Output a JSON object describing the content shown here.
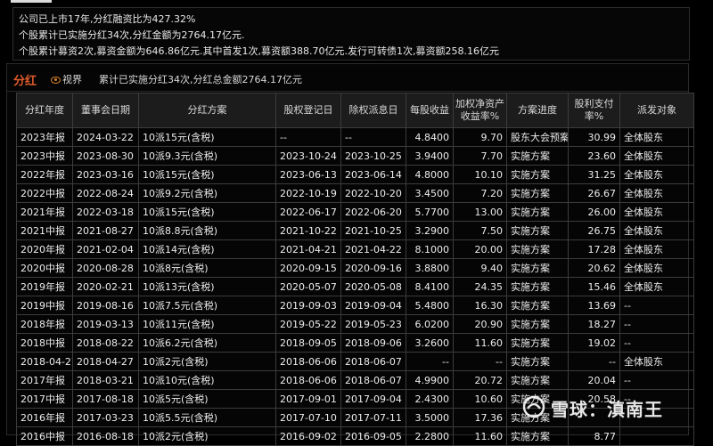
{
  "summary": {
    "line1": "公司已上市17年,分红融资比为427.32%",
    "line2": "个股累计已实施分红34次,分红金额为2764.17亿元.",
    "line3": "个股累计募资2次,募资金额为646.86亿元.其中首发1次,募资额388.70亿元.发行可转债1次,募资额258.16亿元"
  },
  "section": {
    "title": "分红",
    "view_label": "视界",
    "summary": "累计已实施分红34次,分红总金额2764.17亿元"
  },
  "table": {
    "headers": [
      "分红年度",
      "董事会日期",
      "分红方案",
      "股权登记日",
      "除权派息日",
      "每股收益",
      "加权净资产收益率%",
      "方案进度",
      "股利支付率%",
      "派发对象"
    ],
    "rows": [
      [
        "2023年报",
        "2024-03-22",
        "10派15元(含税)",
        "--",
        "--",
        "4.8400",
        "9.70",
        "股东大会预案",
        "30.99",
        "全体股东"
      ],
      [
        "2023中报",
        "2023-08-30",
        "10派9.3元(含税)",
        "2023-10-24",
        "2023-10-25",
        "3.9400",
        "7.70",
        "实施方案",
        "23.60",
        "全体股东"
      ],
      [
        "2022年报",
        "2023-03-16",
        "10派15元(含税)",
        "2023-06-13",
        "2023-06-14",
        "4.8000",
        "10.10",
        "实施方案",
        "31.25",
        "全体股东"
      ],
      [
        "2022中报",
        "2022-08-24",
        "10派9.2元(含税)",
        "2022-10-19",
        "2022-10-20",
        "3.4500",
        "7.20",
        "实施方案",
        "26.67",
        "全体股东"
      ],
      [
        "2021年报",
        "2022-03-18",
        "10派15元(含税)",
        "2022-06-17",
        "2022-06-20",
        "5.7700",
        "13.00",
        "实施方案",
        "26.00",
        "全体股东"
      ],
      [
        "2021中报",
        "2021-08-27",
        "10派8.8元(含税)",
        "2021-10-22",
        "2021-10-25",
        "3.2900",
        "7.50",
        "实施方案",
        "26.75",
        "全体股东"
      ],
      [
        "2020年报",
        "2021-02-04",
        "10派14元(含税)",
        "2021-04-21",
        "2021-04-22",
        "8.1000",
        "20.00",
        "实施方案",
        "17.28",
        "全体股东"
      ],
      [
        "2020中报",
        "2020-08-28",
        "10派8元(含税)",
        "2020-09-15",
        "2020-09-16",
        "3.8800",
        "9.40",
        "实施方案",
        "20.62",
        "全体股东"
      ],
      [
        "2019年报",
        "2020-02-21",
        "10派13元(含税)",
        "2020-05-07",
        "2020-05-08",
        "8.4100",
        "24.35",
        "实施方案",
        "15.46",
        "全体股东"
      ],
      [
        "2019中报",
        "2019-08-16",
        "10派7.5元(含税)",
        "2019-09-03",
        "2019-09-04",
        "5.4800",
        "16.30",
        "实施方案",
        "13.69",
        "--"
      ],
      [
        "2018年报",
        "2019-03-13",
        "10派11元(含税)",
        "2019-05-22",
        "2019-05-23",
        "6.0200",
        "20.90",
        "实施方案",
        "18.27",
        "--"
      ],
      [
        "2018中报",
        "2018-08-22",
        "10派6.2元(含税)",
        "2018-09-05",
        "2018-09-06",
        "3.2600",
        "11.60",
        "实施方案",
        "19.02",
        "--"
      ],
      [
        "2018-04-27",
        "2018-04-27",
        "10派2元(含税)",
        "2018-06-06",
        "2018-06-07",
        "--",
        "--",
        "实施方案",
        "--",
        "全体股东"
      ],
      [
        "2017年报",
        "2018-03-21",
        "10派10元(含税)",
        "2018-06-06",
        "2018-06-07",
        "4.9900",
        "20.72",
        "实施方案",
        "20.04",
        "--"
      ],
      [
        "2017中报",
        "2017-08-18",
        "10派5元(含税)",
        "2017-09-01",
        "2017-09-04",
        "2.4300",
        "10.60",
        "实施方案",
        "20.58",
        "--"
      ],
      [
        "2016年报",
        "2017-03-23",
        "10派5.5元(含税)",
        "2017-07-10",
        "2017-07-11",
        "3.5000",
        "17.36",
        "实施方案",
        "",
        ""
      ],
      [
        "2016中报",
        "2016-08-18",
        "10派2元(含税)",
        "2016-09-02",
        "2016-09-05",
        "2.2800",
        "11.60",
        "实施方案",
        "8.77",
        ""
      ]
    ]
  },
  "watermark": {
    "text": "雪球：滇南王"
  },
  "colors": {
    "accent": "#e15b2b",
    "eye": "#d9822b",
    "header_bg": "#1c1c1c",
    "border": "#3c3c3c"
  },
  "icons": {
    "view": "eye-icon",
    "brand": "snowball-icon"
  }
}
